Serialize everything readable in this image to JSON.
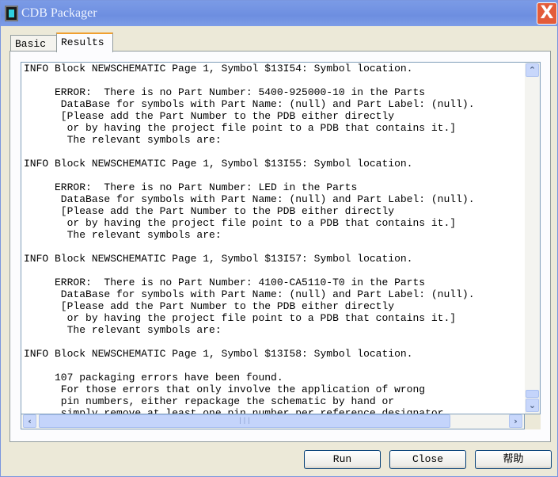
{
  "window": {
    "title": "CDB Packager",
    "close_label": "X"
  },
  "tabs": [
    {
      "label": "Basic",
      "active": false
    },
    {
      "label": "Results",
      "active": true
    }
  ],
  "results": {
    "lines": [
      "INFO Block NEWSCHEMATIC Page 1, Symbol $13I54: Symbol location.",
      "",
      "     ERROR:  There is no Part Number: 5400-925000-10 in the Parts",
      "      DataBase for symbols with Part Name: (null) and Part Label: (null).",
      "      [Please add the Part Number to the PDB either directly",
      "       or by having the project file point to a PDB that contains it.]",
      "       The relevant symbols are:",
      "",
      "INFO Block NEWSCHEMATIC Page 1, Symbol $13I55: Symbol location.",
      "",
      "     ERROR:  There is no Part Number: LED in the Parts",
      "      DataBase for symbols with Part Name: (null) and Part Label: (null).",
      "      [Please add the Part Number to the PDB either directly",
      "       or by having the project file point to a PDB that contains it.]",
      "       The relevant symbols are:",
      "",
      "INFO Block NEWSCHEMATIC Page 1, Symbol $13I57: Symbol location.",
      "",
      "     ERROR:  There is no Part Number: 4100-CA5110-T0 in the Parts",
      "      DataBase for symbols with Part Name: (null) and Part Label: (null).",
      "      [Please add the Part Number to the PDB either directly",
      "       or by having the project file point to a PDB that contains it.]",
      "       The relevant symbols are:",
      "",
      "INFO Block NEWSCHEMATIC Page 1, Symbol $13I58: Symbol location.",
      "",
      "     107 packaging errors have been found.",
      "      For those errors that only involve the application of wrong",
      "      pin numbers, either repackage the schematic by hand or",
      "      simply remove at least one pin number per reference designator"
    ]
  },
  "scroll": {
    "vertical_position": 0.97,
    "horizontal_position": 0
  },
  "buttons": {
    "run": "Run",
    "close": "Close",
    "help": "帮助"
  }
}
